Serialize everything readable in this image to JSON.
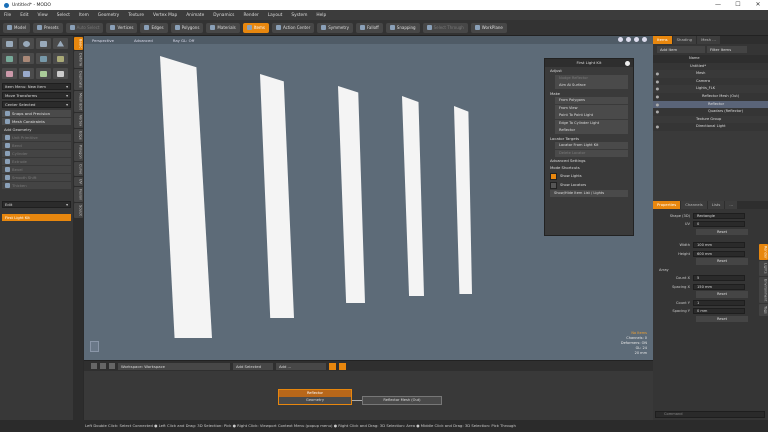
{
  "window": {
    "title": "Untitled* - MODO",
    "controls": [
      "—",
      "☐",
      "✕"
    ]
  },
  "menu": [
    "File",
    "Edit",
    "View",
    "Select",
    "Item",
    "Geometry",
    "Texture",
    "Vertex Map",
    "Animate",
    "Dynamics",
    "Render",
    "Layout",
    "System",
    "Help"
  ],
  "toolbar": {
    "buttons": [
      {
        "label": "Model",
        "icon": "model-icon"
      },
      {
        "label": "Presets",
        "icon": "presets-icon"
      },
      {
        "label": "Auto Select",
        "icon": "auto-select-icon",
        "dim": true
      },
      {
        "label": "Vertices",
        "icon": "vertices-icon"
      },
      {
        "label": "Edges",
        "icon": "edges-icon"
      },
      {
        "label": "Polygons",
        "icon": "polygons-icon"
      },
      {
        "label": "Materials",
        "icon": "materials-icon"
      },
      {
        "label": "Items",
        "icon": "items-icon",
        "active": true
      },
      {
        "label": "Action Center",
        "icon": "action-center-icon"
      },
      {
        "label": "Symmetry",
        "icon": "symmetry-icon"
      },
      {
        "label": "Falloff",
        "icon": "falloff-icon"
      },
      {
        "label": "Snapping",
        "icon": "snapping-icon"
      },
      {
        "label": "Select Through",
        "icon": "select-through-icon",
        "dim": true
      },
      {
        "label": "WorkPlane",
        "icon": "workplane-icon"
      }
    ]
  },
  "left_panel": {
    "vertical_tabs": [
      "Basic",
      "Deform",
      "Duplicate",
      "Mesh Edit",
      "Vertex",
      "Edge",
      "Polygon",
      "Curve",
      "UV",
      "Fusion",
      "Sculpt"
    ],
    "item_menu": "Item Menu: New Item",
    "move_transforms": "Move Transforms",
    "center_selected": "Center Selected",
    "snapping": "Snaps and Precision",
    "mesh_constraints": "Mesh Constraints",
    "add_geometry": "Add Geometry",
    "geometry_items": [
      "Unit Primitive",
      "Bend",
      "Cylinder",
      "Extrude",
      "Bevel",
      "Smooth Shift",
      "Thicken"
    ],
    "edit_label": "Edit",
    "first_light_kit": "First Light Kit"
  },
  "viewport": {
    "header": [
      "Perspective",
      "Advanced",
      "Ray GL: Off"
    ],
    "stats": {
      "warning": "No Items",
      "channels": "Channels: 0",
      "deformers": "Deformers: ON",
      "gl": "GL: 24",
      "distance": "20 mm"
    }
  },
  "light_kit": {
    "title": "First Light Kit",
    "sections": {
      "adjust": "Adjust",
      "adjust_items": [
        {
          "label": "Nudge Reflector",
          "dim": true
        },
        {
          "label": "Aim At Surface",
          "dim": false
        }
      ],
      "make": "Make",
      "make_items": [
        {
          "label": "From Polygons"
        },
        {
          "label": "From View"
        },
        {
          "label": "Point To Point Light"
        },
        {
          "label": "Edge To Cylinder Light"
        },
        {
          "label": "Reflector"
        }
      ],
      "locator": "Locator Targets",
      "locator_items": [
        {
          "label": "Locator From Light Kit",
          "dim": false
        },
        {
          "label": "Delete Locator",
          "dim": true
        }
      ],
      "advanced": "Advanced Settings",
      "mode_shortcuts": "Mode Shortcuts",
      "checks": [
        {
          "label": "Show Lights",
          "on": true
        },
        {
          "label": "Show Locators",
          "on": false
        }
      ],
      "toggle": "Show/Hide Item List / Lights"
    }
  },
  "schematic": {
    "workspace": "Workspace: Workspace",
    "add_selected": "Add Selected",
    "add": "Add ...",
    "node_main": {
      "title": "Reflector",
      "row": "Geometry"
    },
    "node_out": "Reflector Mesh (Out)"
  },
  "status": "Left Double Click: Select Connected ● Left Click and Drag: 3D Selection: Pick ● Right Click: Viewport Context Menu (popup menu) ● Right Click and Drag: 3D Selection: Area ● Middle Click and Drag: 3D Selection: Pick Through",
  "right_panel": {
    "tabs": [
      "Items",
      "Shading",
      "Mesh ..."
    ],
    "add_item": "Add Item",
    "filter_items": "Filter Items",
    "name_header": "Name",
    "tree": [
      {
        "label": "Untitled*",
        "indent": 0,
        "eye": false
      },
      {
        "label": "Mesh",
        "indent": 1,
        "eye": true
      },
      {
        "label": "Camera",
        "indent": 1,
        "eye": true
      },
      {
        "label": "Lights_FLK",
        "indent": 1,
        "eye": true
      },
      {
        "label": "Reflector Mesh (Out)",
        "indent": 2,
        "eye": true
      },
      {
        "label": "Reflector",
        "indent": 3,
        "eye": true,
        "sel": true
      },
      {
        "label": "Quadars (Reflector)",
        "indent": 3,
        "eye": true
      },
      {
        "label": "Texture Group",
        "indent": 1,
        "eye": false
      },
      {
        "label": "Directional Light",
        "indent": 1,
        "eye": true
      }
    ],
    "prop_tabs": [
      "Properties",
      "Channels",
      "Lists",
      "..."
    ],
    "properties": {
      "shape_label": "Shape (3D)",
      "shape_value": "Rectangle",
      "uv_label": "UV",
      "uv_value": "0",
      "reset": "Reset",
      "width_label": "Width",
      "width_value": "100 mm",
      "height_label": "Height",
      "height_value": "600 mm",
      "array_label": "Array",
      "count_x_label": "Count X",
      "count_x_value": "5",
      "spacing_x_label": "Spacing X",
      "spacing_x_value": "150 mm",
      "count_y_label": "Count Y",
      "count_y_value": "1",
      "spacing_y_label": "Spacing Y",
      "spacing_y_value": "0 mm"
    },
    "vtabs": [
      "Render",
      "Lights",
      "Environment",
      "Tags"
    ],
    "command_placeholder": "Command"
  }
}
